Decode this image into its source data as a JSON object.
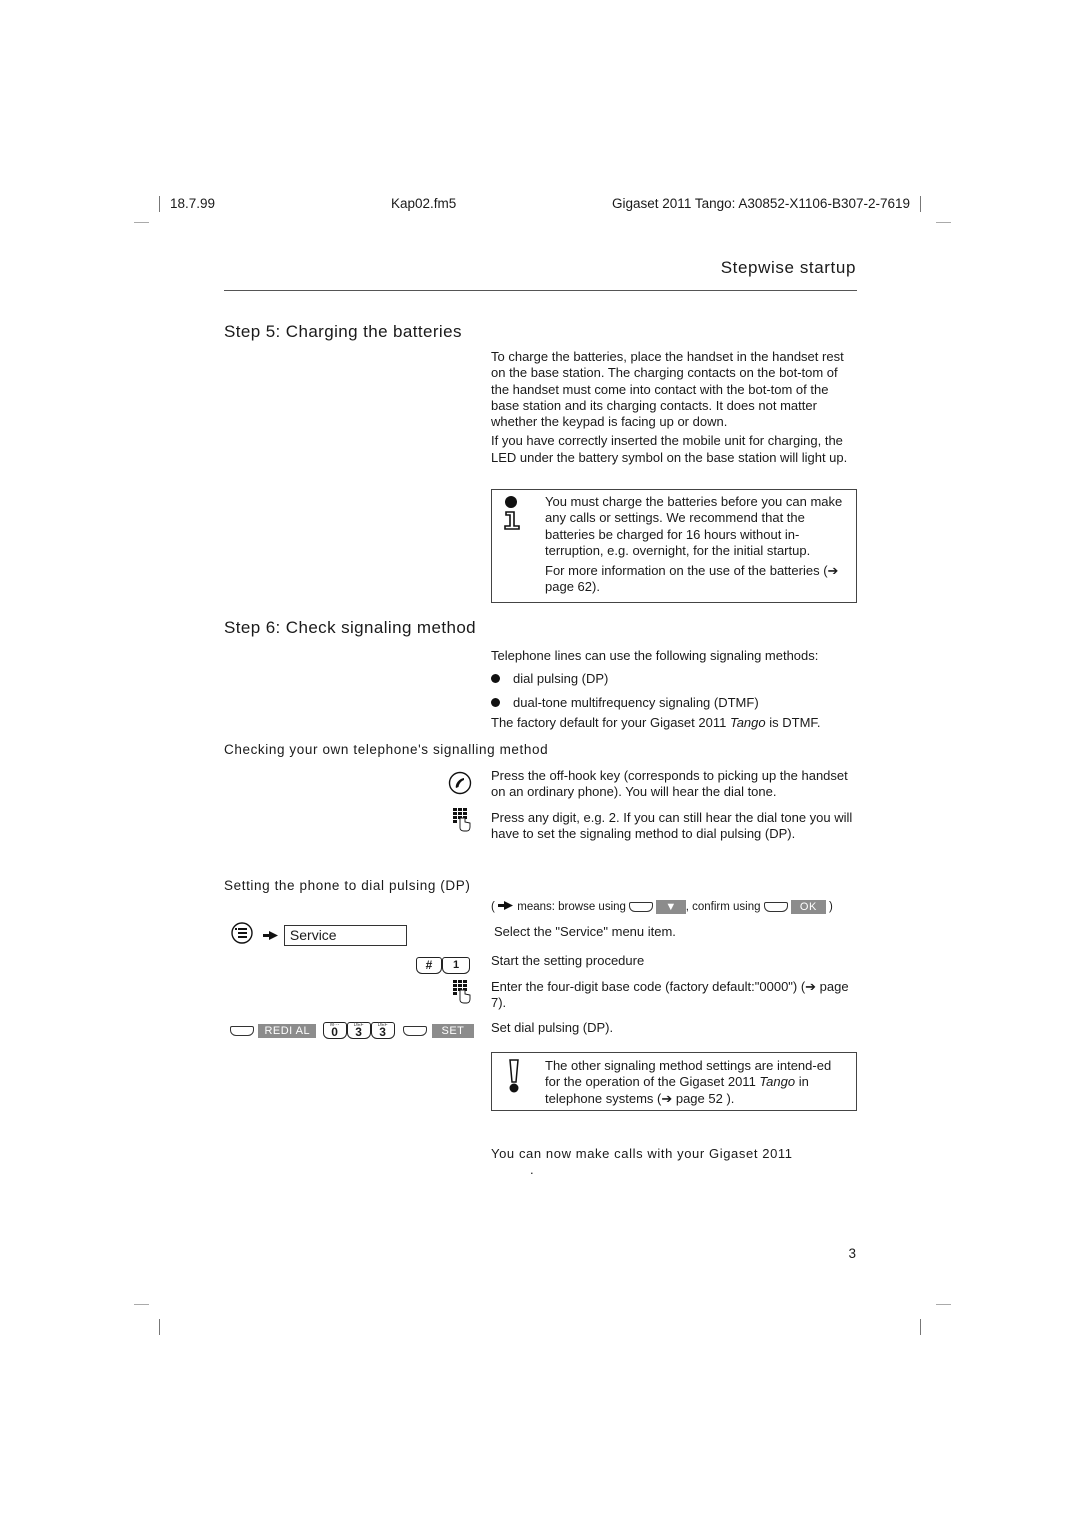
{
  "header": {
    "date": "18.7.99",
    "file": "Kap02.fm5",
    "product": "Gigaset 2011 Tango: A30852-X1106-B307-2-7619"
  },
  "section_title": "Stepwise startup",
  "step5": {
    "title": "Step 5: Charging the batteries",
    "paragraphs": [
      "To charge the batteries, place the handset in the handset rest on the base station. The charging contacts on the bot-tom of the handset must come into contact with the bot-tom of the base station and its charging contacts. It does not matter whether the keypad is facing up or down.",
      "If you have correctly inserted the mobile unit for charging, the LED under the battery symbol on the base station will light up."
    ],
    "note": {
      "icon": "info-icon",
      "paragraphs": [
        "You must charge the batteries before you can make any calls or settings. We recommend that the batteries be charged for 16 hours without in-terruption, e.g. overnight, for the initial startup.",
        "For more information on the use of the batteries (➔ page 62)."
      ]
    }
  },
  "step6": {
    "title": "Step 6: Check signaling method",
    "intro": "Telephone lines can use the following signaling methods:",
    "methods": [
      "dial pulsing (DP)",
      "dual-tone multifrequency signaling (DTMF)"
    ],
    "factory_default_pre": "The factory default for your Gigaset 2011 ",
    "factory_default_italic": "Tango",
    "factory_default_post": " is DTMF.",
    "check_heading": "Checking your own telephone's signalling method",
    "check_steps": [
      {
        "icon": "off-hook-key-icon",
        "text": "Press the off-hook key (corresponds to picking up the handset on an ordinary phone). You will hear the dial tone."
      },
      {
        "icon": "keypad-icon",
        "text": "Press any digit, e.g. 2. If you can still hear the dial tone you will have to set the signaling method to dial pulsing (DP)."
      }
    ],
    "set_heading": "Setting the phone to dial pulsing (DP)",
    "legend": {
      "open": "(",
      "means": "means: browse using",
      "browse_key": "▼",
      "confirm": ", confirm using",
      "confirm_key": "OK",
      "close": ")"
    },
    "menu_item": "Service",
    "select_text": "Select the \"Service\" menu item.",
    "start_keys": [
      "#",
      "1"
    ],
    "start_text": "Start the setting procedure",
    "code_text": "Enter the four-digit base code (factory default:\"0000\") (➔ page 7).",
    "set_sequence": {
      "redial_label": "REDI AL",
      "digit_keys": [
        {
          "sub": "M··-",
          "main": "0"
        },
        {
          "sub": "DEF",
          "main": "3"
        },
        {
          "sub": "DEF",
          "main": "3"
        }
      ],
      "set_label": "SET"
    },
    "set_text": "Set dial pulsing (DP).",
    "warning": {
      "icon": "warning-icon",
      "text_pre": "The other signaling method settings are intend-ed for the operation of the Gigaset 2011 ",
      "text_italic": "Tango",
      "text_post": " in telephone systems (➔ page 52 )."
    },
    "closing": "You can now make calls with your Gigaset 2011",
    "closing_line2": "."
  },
  "page_number": "3",
  "colors": {
    "display_key": "#8c8c8c",
    "text": "#1a1a1a"
  }
}
